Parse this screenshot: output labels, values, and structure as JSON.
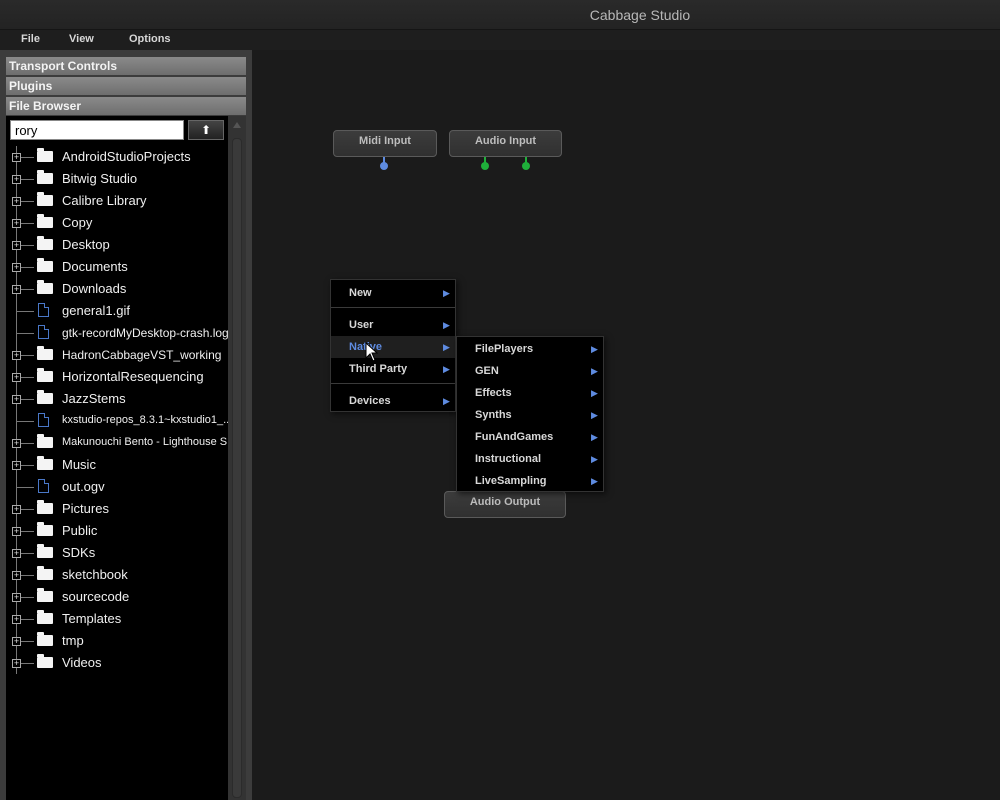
{
  "window": {
    "title": "Cabbage Studio"
  },
  "menubar": {
    "items": [
      "File",
      "View",
      "Options"
    ]
  },
  "sidebar": {
    "sections": [
      "Transport Controls",
      "Plugins",
      "File Browser"
    ],
    "search": {
      "value": "rory"
    },
    "up_button": "⬆",
    "tree": [
      {
        "label": "AndroidStudioProjects",
        "type": "folder"
      },
      {
        "label": "Bitwig Studio",
        "type": "folder"
      },
      {
        "label": "Calibre Library",
        "type": "folder"
      },
      {
        "label": "Copy",
        "type": "folder"
      },
      {
        "label": "Desktop",
        "type": "folder"
      },
      {
        "label": "Documents",
        "type": "folder"
      },
      {
        "label": "Downloads",
        "type": "folder"
      },
      {
        "label": "general1.gif",
        "type": "file"
      },
      {
        "label": "gtk-recordMyDesktop-crash.log",
        "type": "file"
      },
      {
        "label": "HadronCabbageVST_working",
        "type": "folder"
      },
      {
        "label": "HorizontalResequencing",
        "type": "folder"
      },
      {
        "label": "JazzStems",
        "type": "folder"
      },
      {
        "label": "kxstudio-repos_8.3.1~kxstudio1_...",
        "type": "file"
      },
      {
        "label": "Makunouchi Bento - Lighthouse S...",
        "type": "folder"
      },
      {
        "label": "Music",
        "type": "folder"
      },
      {
        "label": "out.ogv",
        "type": "file"
      },
      {
        "label": "Pictures",
        "type": "folder"
      },
      {
        "label": "Public",
        "type": "folder"
      },
      {
        "label": "SDKs",
        "type": "folder"
      },
      {
        "label": "sketchbook",
        "type": "folder"
      },
      {
        "label": "sourcecode",
        "type": "folder"
      },
      {
        "label": "Templates",
        "type": "folder"
      },
      {
        "label": "tmp",
        "type": "folder"
      },
      {
        "label": "Videos",
        "type": "folder"
      }
    ]
  },
  "canvas": {
    "nodes": {
      "midi_input": "Midi Input",
      "audio_input": "Audio Input",
      "audio_output": "Audio Output"
    }
  },
  "context_menu": {
    "items": [
      "New",
      "User",
      "Native",
      "Third Party",
      "Devices"
    ],
    "active": "Native",
    "submenu": [
      "FilePlayers",
      "GEN",
      "Effects",
      "Synths",
      "FunAndGames",
      "Instructional",
      "LiveSampling"
    ]
  },
  "colors": {
    "accent": "#5e8be0",
    "audio_pin": "#1fae3a",
    "midi_pin": "#5e8be0"
  }
}
